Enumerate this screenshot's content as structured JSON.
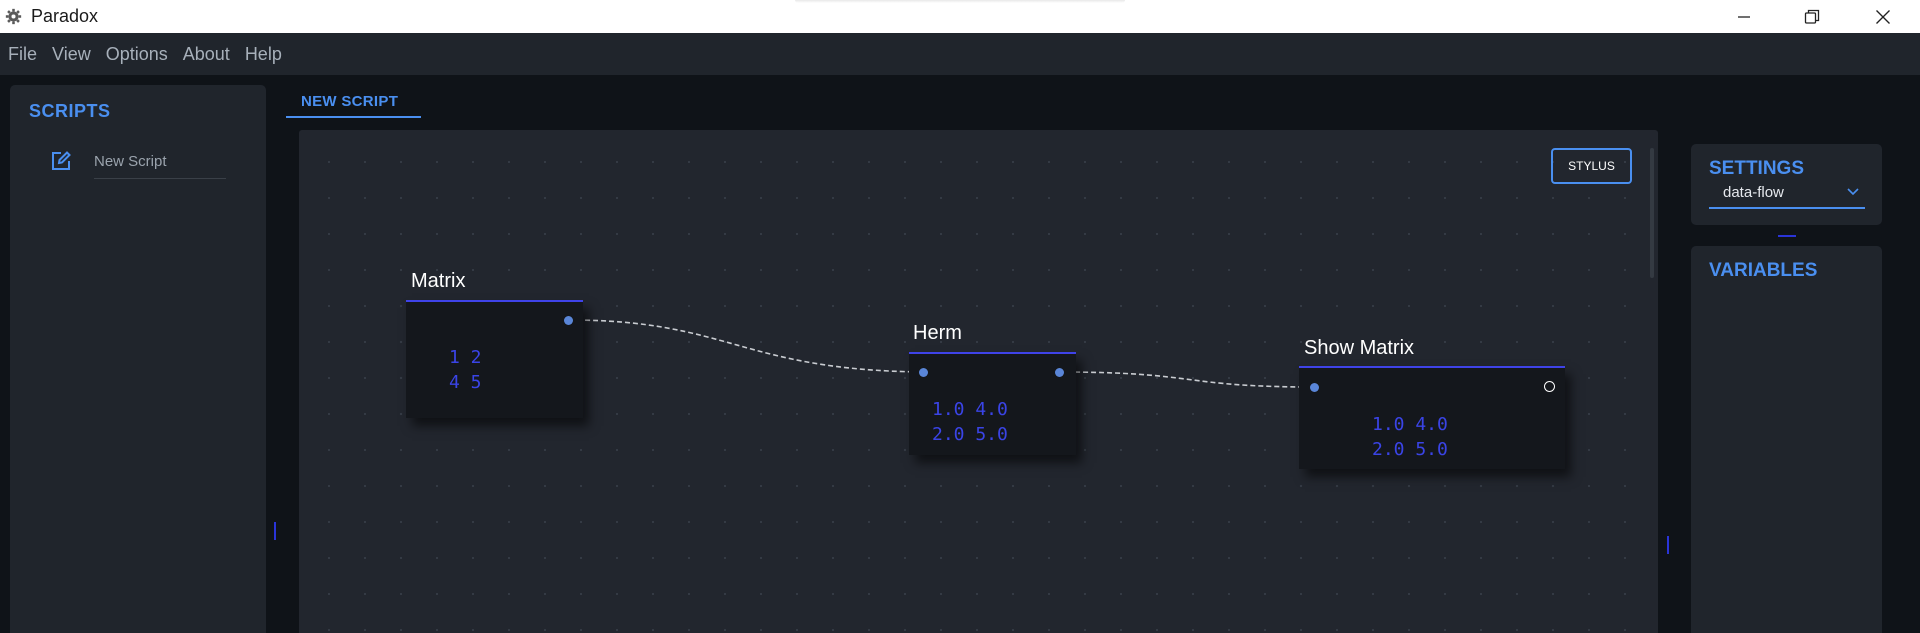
{
  "window": {
    "title": "Paradox"
  },
  "menu": [
    "File",
    "View",
    "Options",
    "About",
    "Help"
  ],
  "scripts": {
    "title": "SCRIPTS",
    "items": [
      {
        "label": "New Script"
      }
    ]
  },
  "tab": {
    "label": "NEW SCRIPT"
  },
  "canvas": {
    "stylus_label": "STYLUS"
  },
  "nodes": [
    {
      "title": "Matrix",
      "output": "1 2\n4 5"
    },
    {
      "title": "Herm",
      "output": "1.0 4.0\n2.0 5.0"
    },
    {
      "title": "Show Matrix",
      "output": "1.0 4.0\n2.0 5.0"
    }
  ],
  "settings": {
    "title": "SETTINGS",
    "mode": "data-flow",
    "options": [
      "data-flow"
    ]
  },
  "variables": {
    "title": "VARIABLES"
  },
  "colors": {
    "accent": "#4a8ff0",
    "node_header": "#3f43e8",
    "output_text": "#3a44e6"
  }
}
